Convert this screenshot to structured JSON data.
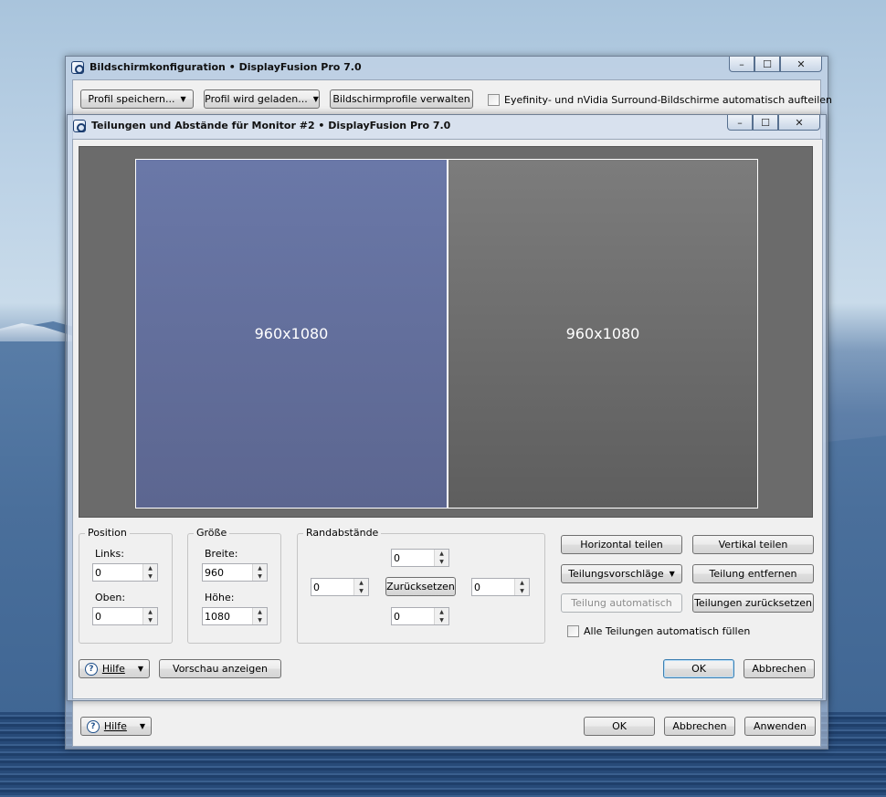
{
  "background_window": {
    "title": "Bildschirmkonfiguration • DisplayFusion Pro 7.0",
    "save_profile_label": "Profil speichern...",
    "load_profile_label": "Profil wird geladen...",
    "manage_profiles_label": "Bildschirmprofile verwalten",
    "eyefinity_label": "Eyefinity- und nVidia Surround-Bildschirme automatisch aufteilen",
    "help_label": "Hilfe",
    "ok_label": "OK",
    "cancel_label": "Abbrechen",
    "apply_label": "Anwenden"
  },
  "dialog": {
    "title": "Teilungen und Abstände für Monitor #2 • DisplayFusion Pro 7.0",
    "preview": {
      "left_split_label": "960x1080",
      "right_split_label": "960x1080"
    },
    "position": {
      "group_label": "Position",
      "left_label": "Links:",
      "left_value": "0",
      "top_label": "Oben:",
      "top_value": "0"
    },
    "size": {
      "group_label": "Größe",
      "width_label": "Breite:",
      "width_value": "960",
      "height_label": "Höhe:",
      "height_value": "1080"
    },
    "margins": {
      "group_label": "Randabstände",
      "top_value": "0",
      "left_value": "0",
      "right_value": "0",
      "bottom_value": "0",
      "reset_label": "Zurücksetzen"
    },
    "actions": {
      "split_horizontal": "Horizontal teilen",
      "split_vertical": "Vertikal teilen",
      "split_suggestions": "Teilungsvorschläge",
      "remove_split": "Teilung entfernen",
      "auto_split": "Teilung automatisch",
      "reset_splits": "Teilungen zurücksetzen",
      "auto_fill_label": "Alle Teilungen automatisch füllen"
    },
    "help_label": "Hilfe",
    "show_preview_label": "Vorschau anzeigen",
    "ok_label": "OK",
    "cancel_label": "Abbrechen"
  }
}
